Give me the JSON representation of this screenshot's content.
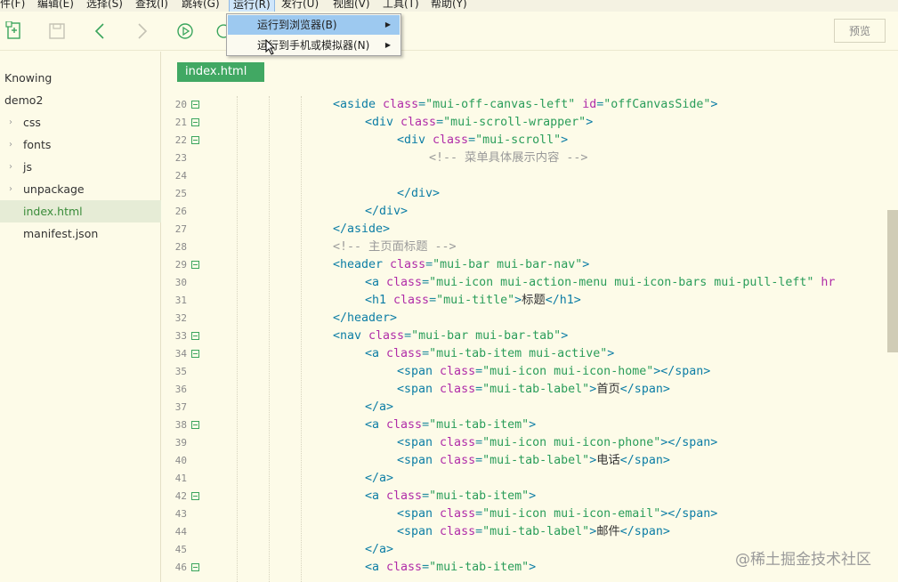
{
  "menubar": {
    "items": [
      {
        "label": "件(F)"
      },
      {
        "label": "编辑(E)"
      },
      {
        "label": "选择(S)"
      },
      {
        "label": "查找(I)"
      },
      {
        "label": "跳转(G)"
      },
      {
        "label": "运行(R)",
        "active": true
      },
      {
        "label": "发行(U)"
      },
      {
        "label": "视图(V)"
      },
      {
        "label": "工具(T)"
      },
      {
        "label": "帮助(Y)"
      }
    ]
  },
  "toolbar": {
    "preview_label": "预览",
    "icons": [
      "new-file-icon",
      "save-icon",
      "back-icon",
      "forward-icon",
      "run-icon",
      "refresh-icon"
    ]
  },
  "run_menu": {
    "items": [
      {
        "label": "运行到浏览器(B)",
        "highlighted": true
      },
      {
        "label": "运行到手机或模拟器(N)",
        "highlighted": false
      }
    ]
  },
  "sidebar": {
    "items": [
      {
        "label": "Knowing",
        "level": 0,
        "folder": false
      },
      {
        "label": "demo2",
        "level": 0,
        "folder": false
      },
      {
        "label": "css",
        "level": 1,
        "folder": true
      },
      {
        "label": "fonts",
        "level": 1,
        "folder": true
      },
      {
        "label": "js",
        "level": 1,
        "folder": true
      },
      {
        "label": "unpackage",
        "level": 1,
        "folder": true
      },
      {
        "label": "index.html",
        "level": 1,
        "folder": false,
        "selected": true
      },
      {
        "label": "manifest.json",
        "level": 1,
        "folder": false
      }
    ]
  },
  "editor": {
    "tab_label": "index.html",
    "lines": [
      {
        "num": "20",
        "fold": true,
        "tokens": [
          [
            "tag",
            "<aside "
          ],
          [
            "attr",
            "class"
          ],
          [
            "punc",
            "="
          ],
          [
            "str",
            "\"mui-off-canvas-left\""
          ],
          [
            "attr",
            " id"
          ],
          [
            "punc",
            "="
          ],
          [
            "str",
            "\"offCanvasSide\""
          ],
          [
            "tag",
            ">"
          ]
        ],
        "indent": 0
      },
      {
        "num": "21",
        "fold": true,
        "tokens": [
          [
            "tag",
            "<div "
          ],
          [
            "attr",
            "class"
          ],
          [
            "punc",
            "="
          ],
          [
            "str",
            "\"mui-scroll-wrapper\""
          ],
          [
            "tag",
            ">"
          ]
        ],
        "indent": 1
      },
      {
        "num": "22",
        "fold": true,
        "tokens": [
          [
            "tag",
            "<div "
          ],
          [
            "attr",
            "class"
          ],
          [
            "punc",
            "="
          ],
          [
            "str",
            "\"mui-scroll\""
          ],
          [
            "tag",
            ">"
          ]
        ],
        "indent": 2
      },
      {
        "num": "23",
        "fold": false,
        "tokens": [
          [
            "cmt",
            "<!-- 菜单具体展示内容 -->"
          ]
        ],
        "indent": 3
      },
      {
        "num": "24",
        "fold": false,
        "tokens": [],
        "indent": 0
      },
      {
        "num": "25",
        "fold": false,
        "tokens": [
          [
            "tag",
            "</div>"
          ]
        ],
        "indent": 2
      },
      {
        "num": "26",
        "fold": false,
        "tokens": [
          [
            "tag",
            "</div>"
          ]
        ],
        "indent": 1
      },
      {
        "num": "27",
        "fold": false,
        "tokens": [
          [
            "tag",
            "</aside>"
          ]
        ],
        "indent": 0
      },
      {
        "num": "28",
        "fold": false,
        "tokens": [
          [
            "cmt",
            "<!-- 主页面标题 -->"
          ]
        ],
        "indent": 0
      },
      {
        "num": "29",
        "fold": true,
        "tokens": [
          [
            "tag",
            "<header "
          ],
          [
            "attr",
            "class"
          ],
          [
            "punc",
            "="
          ],
          [
            "str",
            "\"mui-bar mui-bar-nav\""
          ],
          [
            "tag",
            ">"
          ]
        ],
        "indent": 0
      },
      {
        "num": "30",
        "fold": false,
        "tokens": [
          [
            "tag",
            "<a "
          ],
          [
            "attr",
            "class"
          ],
          [
            "punc",
            "="
          ],
          [
            "str",
            "\"mui-icon mui-action-menu mui-icon-bars mui-pull-left\""
          ],
          [
            "attr",
            " hr"
          ]
        ],
        "indent": 1
      },
      {
        "num": "31",
        "fold": false,
        "tokens": [
          [
            "tag",
            "<h1 "
          ],
          [
            "attr",
            "class"
          ],
          [
            "punc",
            "="
          ],
          [
            "str",
            "\"mui-title\""
          ],
          [
            "tag",
            ">"
          ],
          [
            "plain",
            "标题"
          ],
          [
            "tag",
            "</h1>"
          ]
        ],
        "indent": 1
      },
      {
        "num": "32",
        "fold": false,
        "tokens": [
          [
            "tag",
            "</header>"
          ]
        ],
        "indent": 0
      },
      {
        "num": "33",
        "fold": true,
        "tokens": [
          [
            "tag",
            "<nav "
          ],
          [
            "attr",
            "class"
          ],
          [
            "punc",
            "="
          ],
          [
            "str",
            "\"mui-bar mui-bar-tab\""
          ],
          [
            "tag",
            ">"
          ]
        ],
        "indent": 0
      },
      {
        "num": "34",
        "fold": true,
        "tokens": [
          [
            "tag",
            "<a "
          ],
          [
            "attr",
            "class"
          ],
          [
            "punc",
            "="
          ],
          [
            "str",
            "\"mui-tab-item mui-active\""
          ],
          [
            "tag",
            ">"
          ]
        ],
        "indent": 1
      },
      {
        "num": "35",
        "fold": false,
        "tokens": [
          [
            "tag",
            "<span "
          ],
          [
            "attr",
            "class"
          ],
          [
            "punc",
            "="
          ],
          [
            "str",
            "\"mui-icon mui-icon-home\""
          ],
          [
            "tag",
            "></span>"
          ]
        ],
        "indent": 2
      },
      {
        "num": "36",
        "fold": false,
        "tokens": [
          [
            "tag",
            "<span "
          ],
          [
            "attr",
            "class"
          ],
          [
            "punc",
            "="
          ],
          [
            "str",
            "\"mui-tab-label\""
          ],
          [
            "tag",
            ">"
          ],
          [
            "plain",
            "首页"
          ],
          [
            "tag",
            "</span>"
          ]
        ],
        "indent": 2
      },
      {
        "num": "37",
        "fold": false,
        "tokens": [
          [
            "tag",
            "</a>"
          ]
        ],
        "indent": 1
      },
      {
        "num": "38",
        "fold": true,
        "tokens": [
          [
            "tag",
            "<a "
          ],
          [
            "attr",
            "class"
          ],
          [
            "punc",
            "="
          ],
          [
            "str",
            "\"mui-tab-item\""
          ],
          [
            "tag",
            ">"
          ]
        ],
        "indent": 1
      },
      {
        "num": "39",
        "fold": false,
        "tokens": [
          [
            "tag",
            "<span "
          ],
          [
            "attr",
            "class"
          ],
          [
            "punc",
            "="
          ],
          [
            "str",
            "\"mui-icon mui-icon-phone\""
          ],
          [
            "tag",
            "></span>"
          ]
        ],
        "indent": 2
      },
      {
        "num": "40",
        "fold": false,
        "tokens": [
          [
            "tag",
            "<span "
          ],
          [
            "attr",
            "class"
          ],
          [
            "punc",
            "="
          ],
          [
            "str",
            "\"mui-tab-label\""
          ],
          [
            "tag",
            ">"
          ],
          [
            "plain",
            "电话"
          ],
          [
            "tag",
            "</span>"
          ]
        ],
        "indent": 2
      },
      {
        "num": "41",
        "fold": false,
        "tokens": [
          [
            "tag",
            "</a>"
          ]
        ],
        "indent": 1
      },
      {
        "num": "42",
        "fold": true,
        "tokens": [
          [
            "tag",
            "<a "
          ],
          [
            "attr",
            "class"
          ],
          [
            "punc",
            "="
          ],
          [
            "str",
            "\"mui-tab-item\""
          ],
          [
            "tag",
            ">"
          ]
        ],
        "indent": 1
      },
      {
        "num": "43",
        "fold": false,
        "tokens": [
          [
            "tag",
            "<span "
          ],
          [
            "attr",
            "class"
          ],
          [
            "punc",
            "="
          ],
          [
            "str",
            "\"mui-icon mui-icon-email\""
          ],
          [
            "tag",
            "></span>"
          ]
        ],
        "indent": 2
      },
      {
        "num": "44",
        "fold": false,
        "tokens": [
          [
            "tag",
            "<span "
          ],
          [
            "attr",
            "class"
          ],
          [
            "punc",
            "="
          ],
          [
            "str",
            "\"mui-tab-label\""
          ],
          [
            "tag",
            ">"
          ],
          [
            "plain",
            "邮件"
          ],
          [
            "tag",
            "</span>"
          ]
        ],
        "indent": 2
      },
      {
        "num": "45",
        "fold": false,
        "tokens": [
          [
            "tag",
            "</a>"
          ]
        ],
        "indent": 1
      },
      {
        "num": "46",
        "fold": true,
        "tokens": [
          [
            "tag",
            "<a "
          ],
          [
            "attr",
            "class"
          ],
          [
            "punc",
            "="
          ],
          [
            "str",
            "\"mui-tab-item\""
          ],
          [
            "tag",
            ">"
          ]
        ],
        "indent": 1
      }
    ]
  },
  "watermark": "@稀土掘金技术社区"
}
